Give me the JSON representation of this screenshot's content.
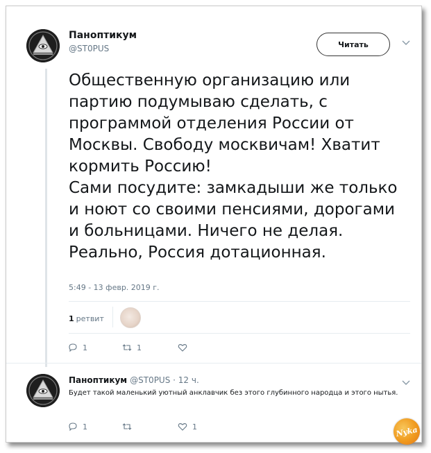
{
  "tweet": {
    "author_name": "Паноптикум",
    "author_handle": "@ST0PUS",
    "follow_label": "Читать",
    "text": "Общественную организацию или\nпартию подумываю сделать, с\nпрограммой отделения России от\nМосквы. Свободу москвичам! Хватит\nкормить Россию!\nСами посудите: замкадыши же только\nи ноют со своими пенсиями, дорогами\nи больницами. Ничего не делая.\nРеально, Россия дотационная.",
    "timestamp": "5:49 - 13 февр. 2019 г.",
    "retweet_count": "1",
    "retweet_label": "ретвит",
    "actions": {
      "replies": "1",
      "retweets": "1",
      "likes": ""
    }
  },
  "reply": {
    "author_name": "Паноптикум",
    "meta": "@ST0PUS · 12 ч.",
    "text": "Будет такой маленький уютный анклавчик без этого глубинного народца и этого нытья.",
    "actions": {
      "replies": "1",
      "retweets": "",
      "likes": "1"
    }
  },
  "watermark_text": "Nyka",
  "icons": [
    "eye-pyramid-avatar",
    "chevron-down-icon",
    "reply-icon",
    "retweet-icon",
    "like-icon"
  ]
}
